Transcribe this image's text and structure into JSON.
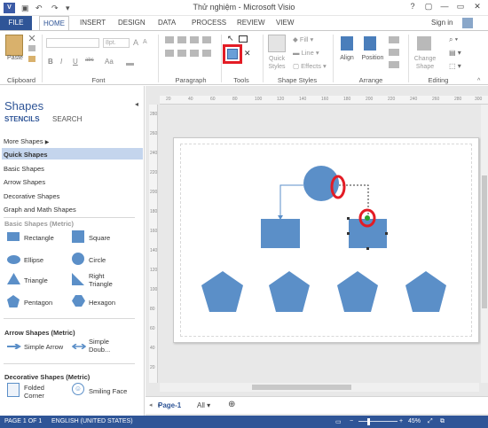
{
  "window": {
    "title": "Thử nghiệm - Microsoft Visio",
    "app_icon": "V",
    "quick_access": [
      "save-icon",
      "undo-icon",
      "redo-icon",
      "customize-icon"
    ],
    "controls": [
      "?",
      "▢",
      "—",
      "▭",
      "✕"
    ]
  },
  "ribbon": {
    "tabs": [
      "FILE",
      "HOME",
      "INSERT",
      "DESIGN",
      "DATA",
      "PROCESS",
      "REVIEW",
      "VIEW"
    ],
    "active_tab": "HOME",
    "signin": "Sign in",
    "groups": {
      "clipboard": {
        "label": "Clipboard",
        "paste": "Paste"
      },
      "font": {
        "label": "Font",
        "size_placeholder": "8pt.",
        "buttons": [
          "B",
          "I",
          "U",
          "abc",
          "Aa",
          "A",
          "A"
        ]
      },
      "paragraph": {
        "label": "Paragraph"
      },
      "tools": {
        "label": "Tools"
      },
      "shape_styles": {
        "label": "Shape Styles",
        "quick_styles": "Quick Styles",
        "fill": "Fill",
        "line": "Line",
        "effects": "Effects"
      },
      "arrange": {
        "label": "Arrange",
        "align": "Align",
        "position": "Position"
      },
      "editing": {
        "label": "Editing",
        "change_shape": "Change Shape"
      }
    }
  },
  "shapes_pane": {
    "title": "Shapes",
    "tabs": [
      "STENCILS",
      "SEARCH"
    ],
    "nav": [
      "More Shapes",
      "Quick Shapes",
      "Basic Shapes",
      "Arrow Shapes",
      "Decorative Shapes",
      "Graph and Math Shapes"
    ],
    "selected_nav": "Quick Shapes",
    "basic_title": "Basic Shapes (Metric)",
    "basic_shapes": [
      "Rectangle",
      "Square",
      "Ellipse",
      "Circle",
      "Triangle",
      "Right Triangle",
      "Pentagon",
      "Hexagon"
    ],
    "arrow_title": "Arrow Shapes (Metric)",
    "arrow_shapes": [
      "Simple Arrow",
      "Simple Doub..."
    ],
    "decorative_title": "Decorative Shapes (Metric)",
    "decorative_shapes": [
      "Folded Corner",
      "Smiling Face"
    ]
  },
  "ruler": {
    "top": [
      "20",
      "40",
      "60",
      "80",
      "100",
      "120",
      "140",
      "160",
      "180",
      "200",
      "220",
      "240",
      "260",
      "280",
      "300"
    ],
    "left": [
      "280",
      "260",
      "240",
      "220",
      "200",
      "180",
      "160",
      "140",
      "120",
      "100",
      "80",
      "60",
      "40",
      "20"
    ]
  },
  "page_tabs": {
    "current": "Page-1",
    "all": "All",
    "add": "⊕"
  },
  "status": {
    "page": "PAGE 1 OF 1",
    "language": "ENGLISH (UNITED STATES)",
    "zoom": "45%"
  },
  "colors": {
    "accent": "#2f5597",
    "shape_fill": "#5b8fc8",
    "highlight": "#e31c25"
  }
}
